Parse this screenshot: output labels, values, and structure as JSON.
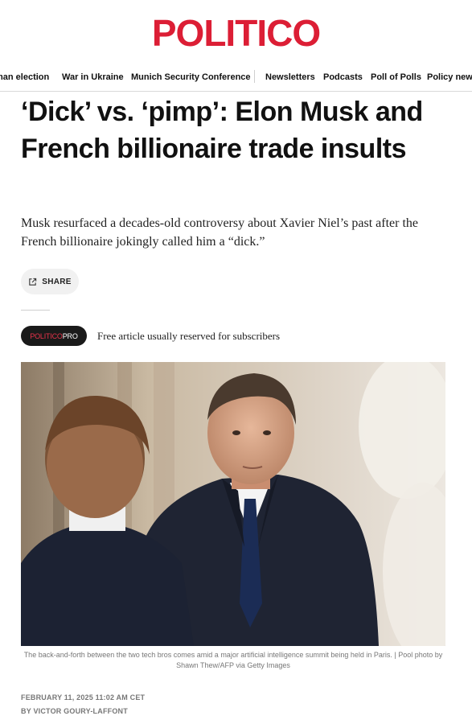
{
  "brand": {
    "logo_text": "POLITICO",
    "accent": "#dc1e35"
  },
  "nav": {
    "items": [
      "man election",
      "War in Ukraine",
      "Munich Security Conference",
      "Newsletters",
      "Podcasts",
      "Poll of Polls",
      "Policy news"
    ]
  },
  "article": {
    "headline": "‘Dick’ vs. ‘pimp’: Elon Musk and French billionaire trade insults",
    "dek": "Musk resurfaced a decades-old controversy about Xavier Niel’s past after the French billionaire jokingly called him a “dick.”",
    "share_label": "SHARE",
    "pro_badge": {
      "part1": "POLITICO",
      "part2": "PRO"
    },
    "pro_text": "Free article usually reserved for subscribers",
    "image_caption": "The back-and-forth between the two tech bros comes amid a major artificial intelligence summit being held in Paris. | Pool photo by Shawn Thew/AFP via Getty Images",
    "date": "FEBRUARY 11, 2025 11:02 AM CET",
    "byline": "BY VICTOR GOURY-LAFFONT"
  }
}
